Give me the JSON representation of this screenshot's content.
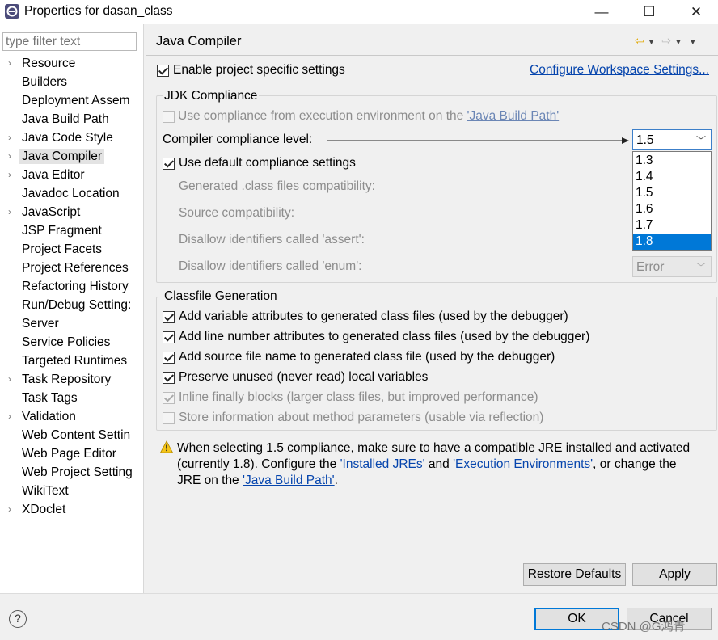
{
  "window": {
    "title": "Properties for dasan_class",
    "minimize": "—",
    "maximize": "☐",
    "close": "✕"
  },
  "sidebar": {
    "filter_placeholder": "type filter text",
    "items": [
      {
        "label": "Resource",
        "expandable": true
      },
      {
        "label": "Builders",
        "expandable": false
      },
      {
        "label": "Deployment Assem",
        "expandable": false
      },
      {
        "label": "Java Build Path",
        "expandable": false
      },
      {
        "label": "Java Code Style",
        "expandable": true
      },
      {
        "label": "Java Compiler",
        "expandable": true,
        "selected": true
      },
      {
        "label": "Java Editor",
        "expandable": true
      },
      {
        "label": "Javadoc Location",
        "expandable": false
      },
      {
        "label": "JavaScript",
        "expandable": true
      },
      {
        "label": "JSP Fragment",
        "expandable": false
      },
      {
        "label": "Project Facets",
        "expandable": false
      },
      {
        "label": "Project References",
        "expandable": false
      },
      {
        "label": "Refactoring History",
        "expandable": false
      },
      {
        "label": "Run/Debug Setting:",
        "expandable": false
      },
      {
        "label": "Server",
        "expandable": false
      },
      {
        "label": "Service Policies",
        "expandable": false
      },
      {
        "label": "Targeted Runtimes",
        "expandable": false
      },
      {
        "label": "Task Repository",
        "expandable": true
      },
      {
        "label": "Task Tags",
        "expandable": false
      },
      {
        "label": "Validation",
        "expandable": true
      },
      {
        "label": "Web Content Settin",
        "expandable": false
      },
      {
        "label": "Web Page Editor",
        "expandable": false
      },
      {
        "label": "Web Project Setting",
        "expandable": false
      },
      {
        "label": "WikiText",
        "expandable": false
      },
      {
        "label": "XDoclet",
        "expandable": true
      }
    ]
  },
  "page": {
    "title": "Java Compiler",
    "enable_specific": "Enable project specific settings",
    "configure_workspace": "Configure Workspace Settings...",
    "jdk": {
      "group_title": "JDK Compliance",
      "use_env_prefix": "Use compliance from execution environment on the ",
      "use_env_link": "'Java Build Path'",
      "level_label": "Compiler compliance level:",
      "level_value": "1.5",
      "level_options": [
        "1.3",
        "1.4",
        "1.5",
        "1.6",
        "1.7",
        "1.8"
      ],
      "highlighted_option": "1.8",
      "use_default": "Use default compliance settings",
      "generated": "Generated .class files compatibility:",
      "source": "Source compatibility:",
      "assert": "Disallow identifiers called 'assert':",
      "enum": "Disallow identifiers called 'enum':",
      "enum_value": "Error"
    },
    "classfile": {
      "group_title": "Classfile Generation",
      "options": [
        {
          "label": "Add variable attributes to generated class files (used by the debugger)",
          "checked": true,
          "enabled": true
        },
        {
          "label": "Add line number attributes to generated class files (used by the debugger)",
          "checked": true,
          "enabled": true
        },
        {
          "label": "Add source file name to generated class file (used by the debugger)",
          "checked": true,
          "enabled": true
        },
        {
          "label": "Preserve unused (never read) local variables",
          "checked": true,
          "enabled": true
        },
        {
          "label": "Inline finally blocks (larger class files, but improved performance)",
          "checked": true,
          "enabled": false
        },
        {
          "label": "Store information about method parameters (usable via reflection)",
          "checked": false,
          "enabled": false
        }
      ]
    },
    "warning": {
      "line1": "When selecting 1.5 compliance, make sure to have a compatible JRE installed and activated",
      "line2_prefix": "(currently 1.8). Configure the ",
      "link_jres": "'Installed JREs'",
      "and": " and ",
      "link_envs": "'Execution Environments'",
      "line2_suffix": ", or change the",
      "line3_prefix": "JRE on the ",
      "link_build_path": "'Java Build Path'",
      "line3_suffix": "."
    },
    "restore_defaults": "Restore Defaults",
    "apply": "Apply"
  },
  "footer": {
    "help": "?",
    "ok": "OK",
    "cancel": "Cancel"
  },
  "watermark": "CSDN @G鸿青",
  "colors": {
    "accent": "#0078d7",
    "link": "#0645ad",
    "warning": "#e8b400"
  }
}
